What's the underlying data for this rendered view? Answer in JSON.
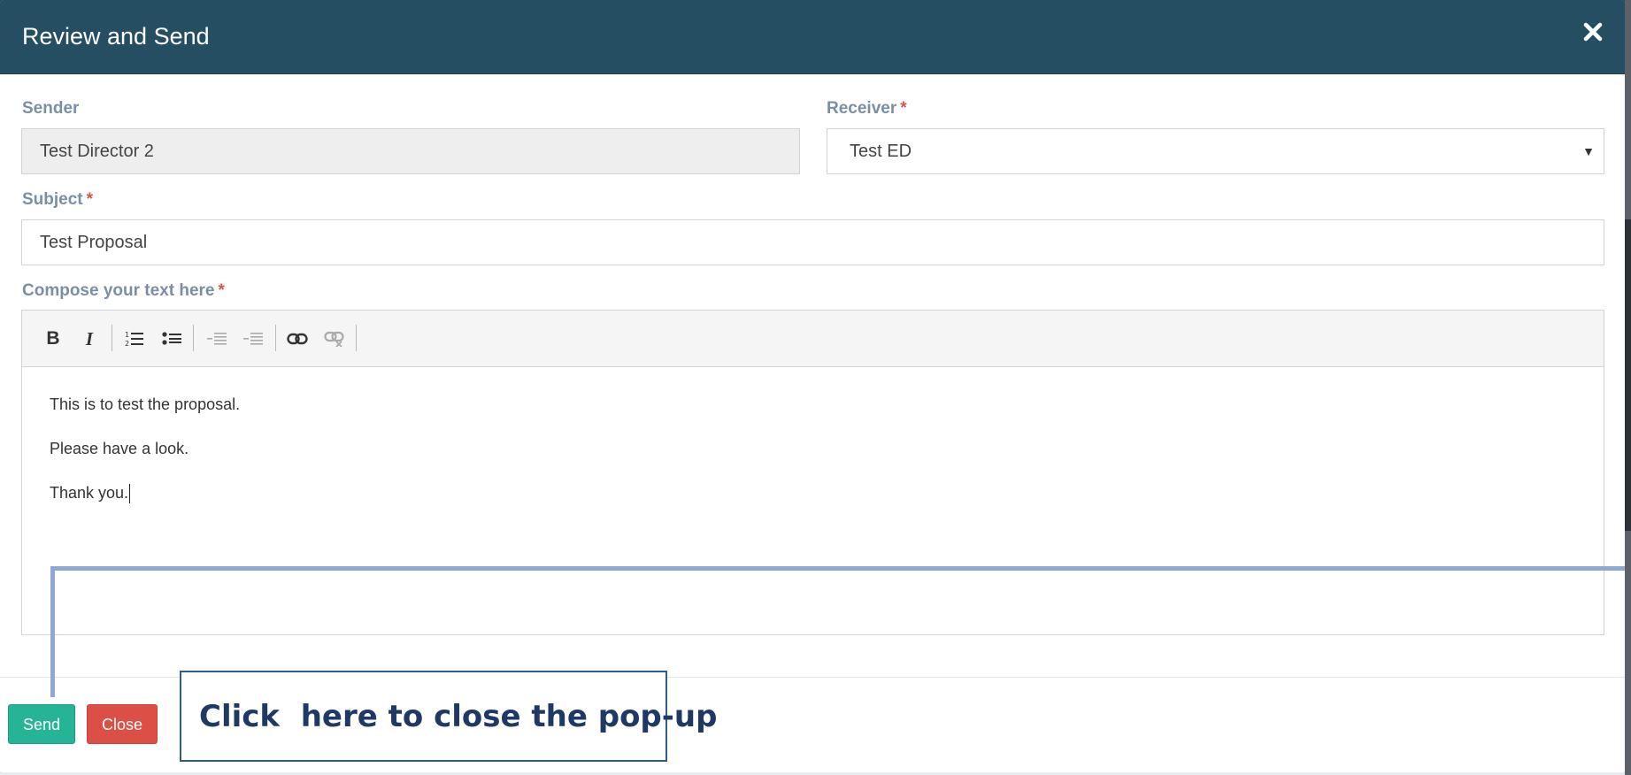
{
  "modal": {
    "title": "Review and Send"
  },
  "form": {
    "sender": {
      "label": "Sender",
      "value": "Test Director 2"
    },
    "receiver": {
      "label": "Receiver",
      "required": "*",
      "value": "Test ED"
    },
    "subject": {
      "label": "Subject",
      "required": "*",
      "value": "Test Proposal"
    },
    "compose": {
      "label": "Compose your text here",
      "required": "*"
    }
  },
  "editor": {
    "toolbar": {
      "bold": "B",
      "italic": "I"
    },
    "lines": [
      "This is to test the proposal.",
      "Please have a look.",
      "Thank you."
    ]
  },
  "footer": {
    "send_label": "Send",
    "close_label": "Close"
  },
  "callout": {
    "text": "Click  here to close the pop-up"
  },
  "colors": {
    "header": "#254e63",
    "send": "#26b497",
    "close": "#dc4f47",
    "callout_text": "#1f3864",
    "pointer": "#8ea9d4"
  }
}
